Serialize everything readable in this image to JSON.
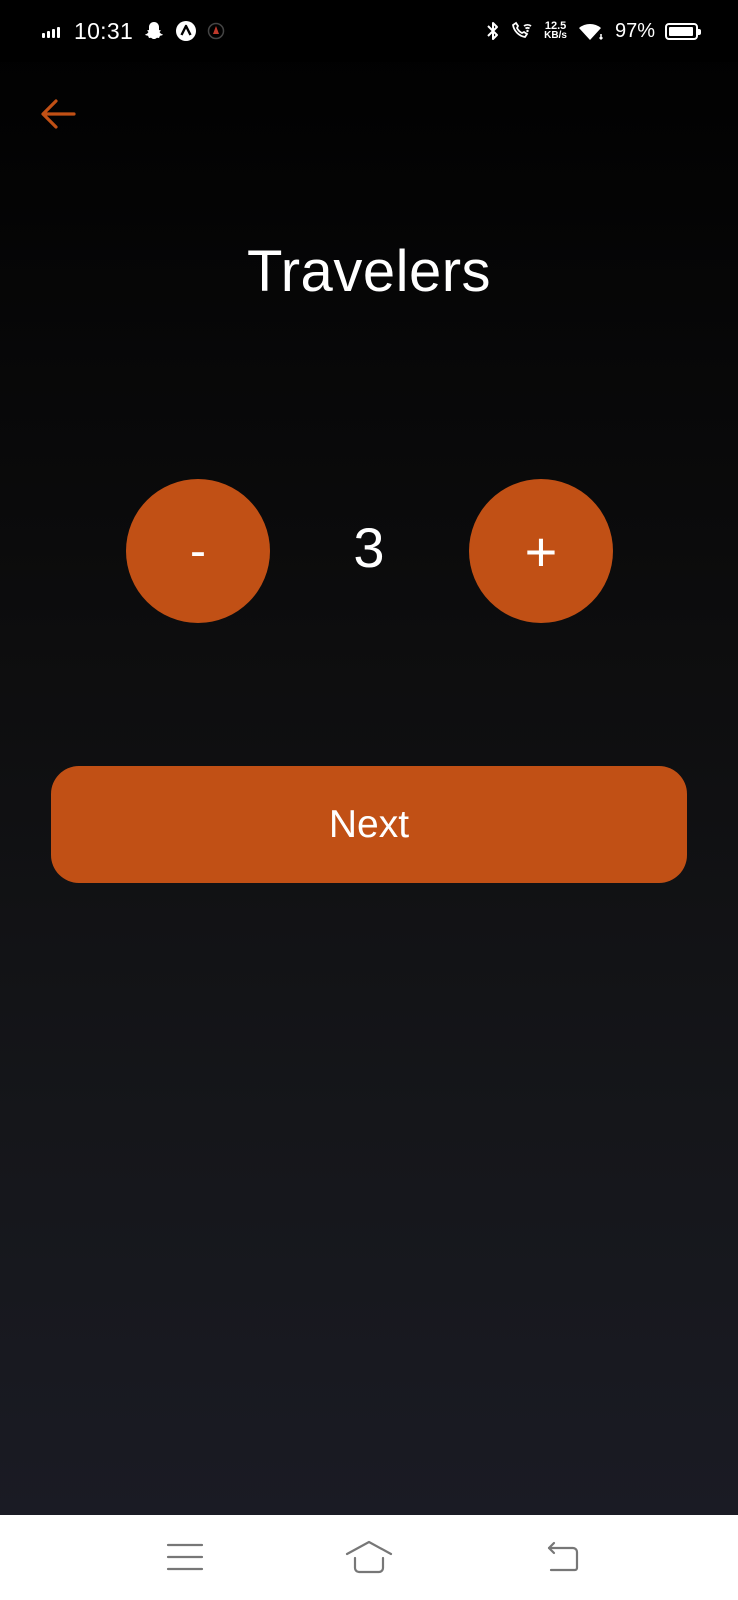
{
  "status_bar": {
    "time": "10:31",
    "speed_value": "12.5",
    "speed_unit": "KB/s",
    "battery": "97%",
    "battery_level": 0.97
  },
  "screen": {
    "title": "Travelers",
    "decrement_label": "-",
    "count": "3",
    "increment_label": "+",
    "next_label": "Next"
  },
  "colors": {
    "accent": "#c15015",
    "background_top": "#000000",
    "background_bottom": "#1b1c26"
  },
  "icons": {
    "back": "arrow-left-icon",
    "nav_menu": "menu-icon",
    "nav_home": "home-icon",
    "nav_back": "back-icon"
  }
}
